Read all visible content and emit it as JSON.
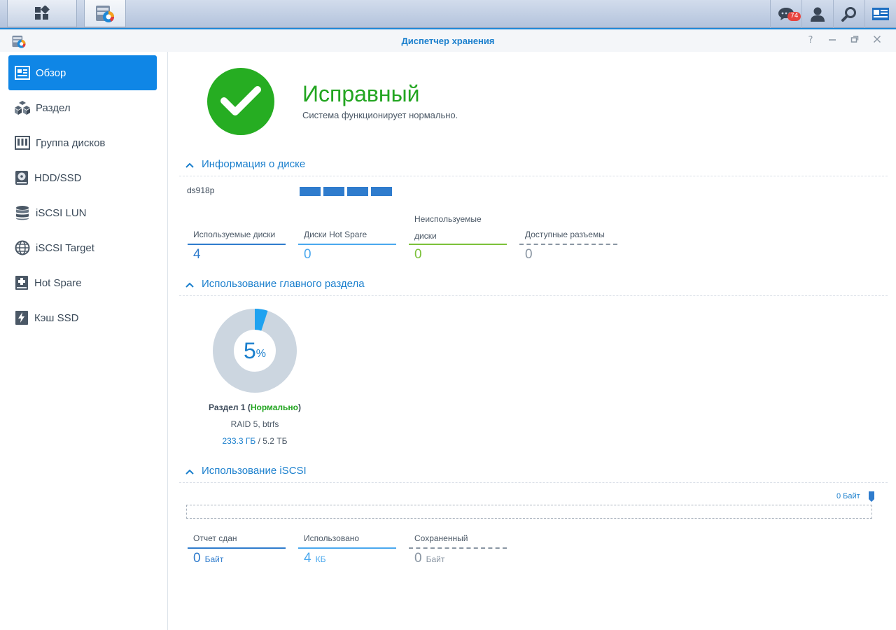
{
  "taskbar": {
    "notification_count": "74",
    "icons": [
      "apps-grid-icon",
      "storage-manager-app-icon",
      "chat-notification-icon",
      "user-icon",
      "search-icon",
      "widgets-icon"
    ]
  },
  "window": {
    "title": "Диспетчер хранения",
    "controls": [
      "help-icon",
      "minimize-icon",
      "restore-icon",
      "close-icon"
    ]
  },
  "sidebar": {
    "items": [
      {
        "label": "Обзор",
        "icon": "overview-icon",
        "active": true
      },
      {
        "label": "Раздел",
        "icon": "volume-icon",
        "active": false
      },
      {
        "label": "Группа дисков",
        "icon": "disk-group-icon",
        "active": false
      },
      {
        "label": "HDD/SSD",
        "icon": "hdd-icon",
        "active": false
      },
      {
        "label": "iSCSI LUN",
        "icon": "lun-icon",
        "active": false
      },
      {
        "label": "iSCSI Target",
        "icon": "target-icon",
        "active": false
      },
      {
        "label": "Hot Spare",
        "icon": "hot-spare-icon",
        "active": false
      },
      {
        "label": "Кэш SSD",
        "icon": "ssd-cache-icon",
        "active": false
      }
    ]
  },
  "status": {
    "title": "Исправный",
    "subtitle": "Система функционирует нормально.",
    "color": "#26ad22"
  },
  "disk_info": {
    "section_title": "Информация о диске",
    "device_name": "ds918p",
    "slots": 4,
    "stats": [
      {
        "label": "Используемые диски",
        "value": "4",
        "color": "#2f7ccd"
      },
      {
        "label": "Диски Hot Spare",
        "value": "0",
        "color": "#4aa8ee"
      },
      {
        "label": "Неиспользуемые диски",
        "value": "0",
        "color": "#7cc13a"
      },
      {
        "label": "Доступные разъемы",
        "value": "0",
        "color": "#8a96a3"
      }
    ]
  },
  "volume_usage": {
    "section_title": "Использование главного раздела",
    "percent": "5",
    "percent_sign": "%",
    "percent_value": 5,
    "name": "Раздел 1",
    "state": "Нормально",
    "raid": "RAID 5, btrfs",
    "used": "233.3 ГБ",
    "total": "5.2 ТБ",
    "colors": {
      "used": "#1fa2f0",
      "free": "#ccd6e0"
    }
  },
  "iscsi": {
    "section_title": "Использование iSCSI",
    "max_label": "0 Байт",
    "stats": [
      {
        "label": "Отчет сдан",
        "value": "0",
        "unit": "Байт",
        "color": "#2f7ccd"
      },
      {
        "label": "Использовано",
        "value": "4",
        "unit": "КБ",
        "color": "#4aa8ee"
      },
      {
        "label": "Сохраненный",
        "value": "0",
        "unit": "Байт",
        "color": "#8a96a3"
      }
    ]
  }
}
